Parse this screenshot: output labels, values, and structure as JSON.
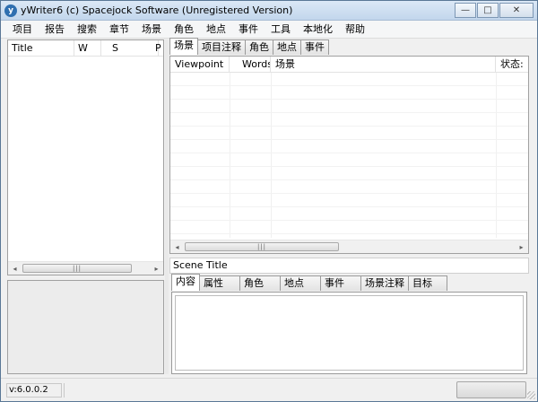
{
  "window": {
    "icon_glyph": "y",
    "title": "yWriter6 (c) Spacejock Software (Unregistered Version)",
    "min_glyph": "—",
    "max_glyph": "□",
    "close_glyph": "✕"
  },
  "menu": [
    "项目",
    "报告",
    "搜索",
    "章节",
    "场景",
    "角色",
    "地点",
    "事件",
    "工具",
    "本地化",
    "帮助"
  ],
  "chapter_list": {
    "columns": [
      "Title",
      "W",
      "S",
      "P"
    ]
  },
  "scroll": {
    "left_arrow": "◂",
    "right_arrow": "▸",
    "thumb_grip": "|||"
  },
  "top_tabs": [
    "场景",
    "项目注释",
    "角色",
    "地点",
    "事件"
  ],
  "scene_table": {
    "columns": [
      "Viewpoint",
      "Words",
      "场景",
      "状态:"
    ]
  },
  "scene_title": "Scene Title",
  "bottom_tabs": [
    "内容",
    "属性",
    "角色",
    "地点",
    "事件",
    "场景注释",
    "目标"
  ],
  "status": {
    "version": "v:6.0.0.2"
  },
  "colors": {
    "titlebar": "#c2d6ec",
    "window_bg": "#f0f0f0"
  }
}
